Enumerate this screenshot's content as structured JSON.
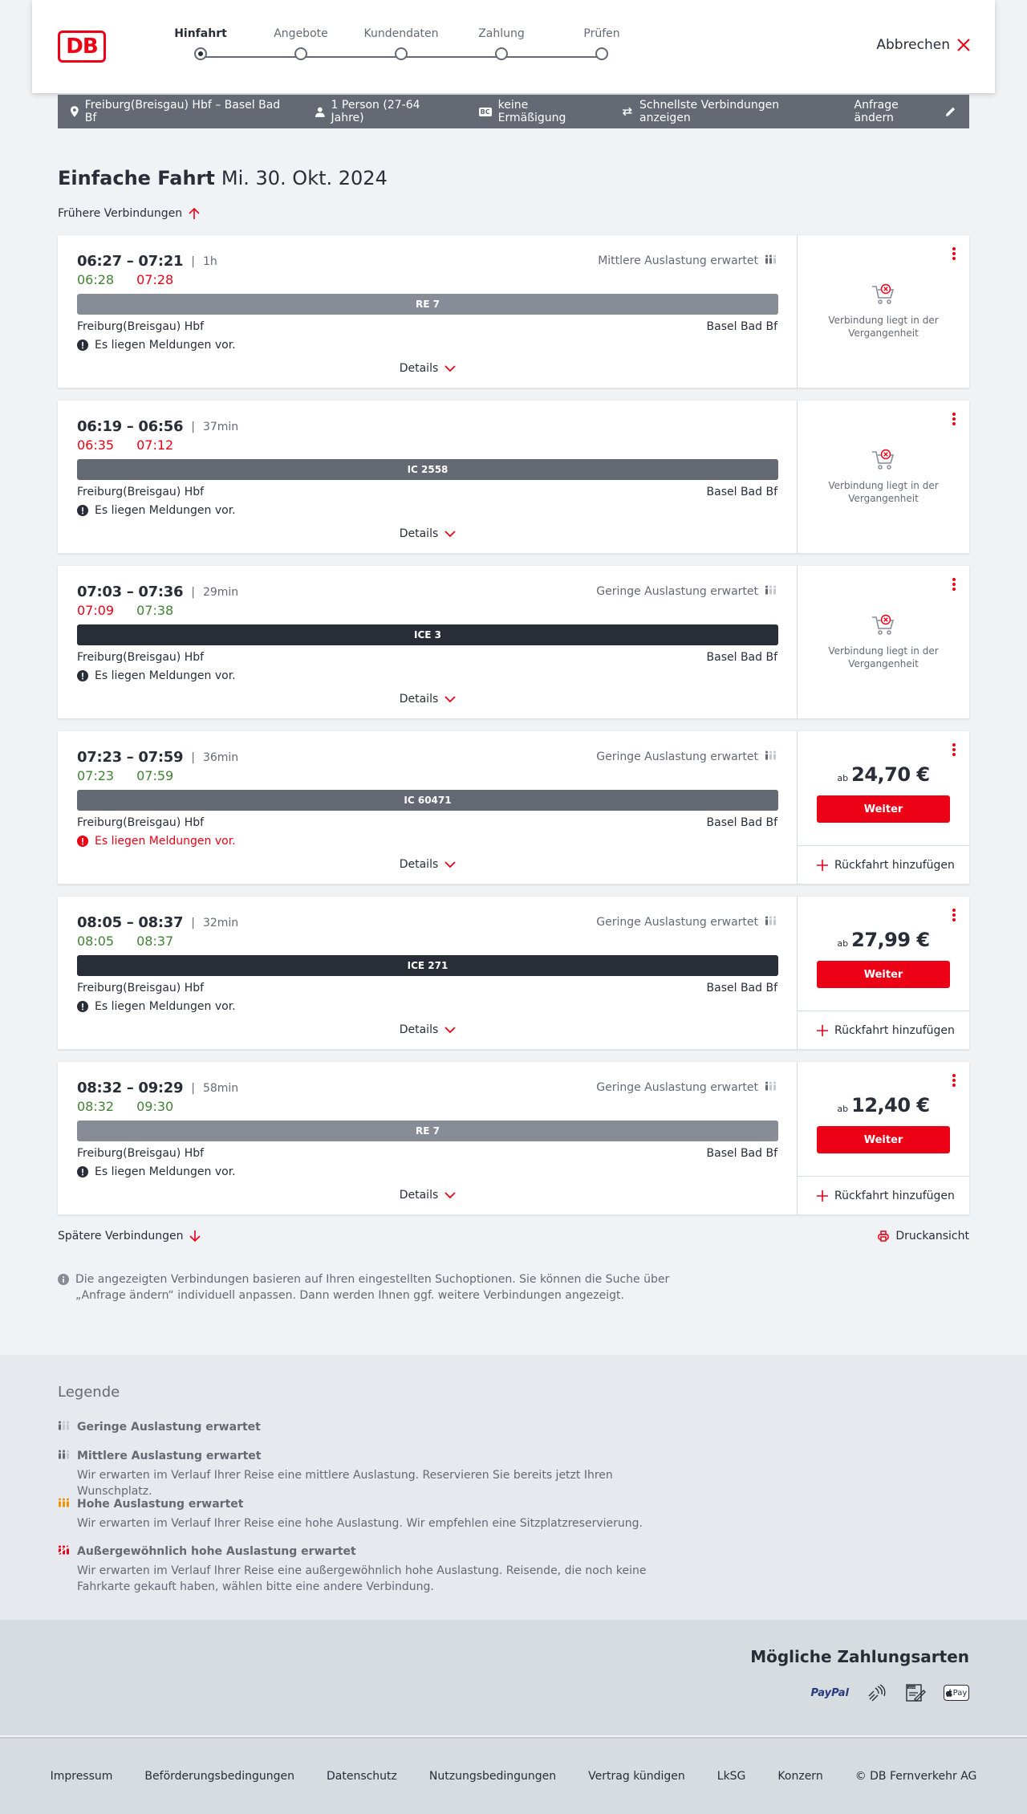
{
  "header": {
    "logo_text": "DB",
    "steps": [
      {
        "label": "Hinfahrt",
        "active": true
      },
      {
        "label": "Angebote",
        "active": false
      },
      {
        "label": "Kundendaten",
        "active": false
      },
      {
        "label": "Zahlung",
        "active": false
      },
      {
        "label": "Prüfen",
        "active": false
      }
    ],
    "cancel_label": "Abbrechen"
  },
  "search": {
    "route": "Freiburg(Breisgau) Hbf – Basel Bad Bf",
    "passengers": "1 Person (27-64 Jahre)",
    "discount_badge": "BC",
    "discount": "keine Ermäßigung",
    "fastest": "Schnellste Verbindungen anzeigen",
    "change": "Anfrage ändern"
  },
  "title": {
    "trip": "Einfache Fahrt",
    "date": "Mi. 30. Okt. 2024"
  },
  "earlier_label": "Frühere Verbindungen",
  "later_label": "Spätere Verbindungen",
  "print_label": "Druckansicht",
  "details_label": "Details",
  "ab_label": "ab",
  "weiter_label": "Weiter",
  "return_label": "Rückfahrt hinzufügen",
  "past_label": "Verbindung liegt in der Vergangenheit",
  "connections": [
    {
      "planned": "06:27 – 07:21",
      "duration": "1h",
      "rt_dep": "06:28",
      "rt_dep_color": "green",
      "rt_arr": "07:28",
      "rt_arr_color": "red",
      "occupancy": "Mittlere Auslastung erwartet",
      "train": "RE 7",
      "train_type": "re",
      "from": "Freiburg(Breisgau) Hbf",
      "to": "Basel Bad Bf",
      "message": "Es liegen Meldungen vor.",
      "message_alert": false,
      "past": true,
      "price": ""
    },
    {
      "planned": "06:19 – 06:56",
      "duration": "37min",
      "rt_dep": "06:35",
      "rt_dep_color": "red",
      "rt_arr": "07:12",
      "rt_arr_color": "red",
      "occupancy": "",
      "train": "IC 2558",
      "train_type": "ic",
      "from": "Freiburg(Breisgau) Hbf",
      "to": "Basel Bad Bf",
      "message": "Es liegen Meldungen vor.",
      "message_alert": false,
      "past": true,
      "price": ""
    },
    {
      "planned": "07:03 – 07:36",
      "duration": "29min",
      "rt_dep": "07:09",
      "rt_dep_color": "red",
      "rt_arr": "07:38",
      "rt_arr_color": "green",
      "occupancy": "Geringe Auslastung erwartet",
      "train": "ICE 3",
      "train_type": "ice",
      "from": "Freiburg(Breisgau) Hbf",
      "to": "Basel Bad Bf",
      "message": "Es liegen Meldungen vor.",
      "message_alert": false,
      "past": true,
      "price": ""
    },
    {
      "planned": "07:23 – 07:59",
      "duration": "36min",
      "rt_dep": "07:23",
      "rt_dep_color": "green",
      "rt_arr": "07:59",
      "rt_arr_color": "green",
      "occupancy": "Geringe Auslastung erwartet",
      "train": "IC 60471",
      "train_type": "ic",
      "from": "Freiburg(Breisgau) Hbf",
      "to": "Basel Bad Bf",
      "message": "Es liegen Meldungen vor.",
      "message_alert": true,
      "past": false,
      "price": "24,70 €"
    },
    {
      "planned": "08:05 – 08:37",
      "duration": "32min",
      "rt_dep": "08:05",
      "rt_dep_color": "green",
      "rt_arr": "08:37",
      "rt_arr_color": "green",
      "occupancy": "Geringe Auslastung erwartet",
      "train": "ICE 271",
      "train_type": "ice",
      "from": "Freiburg(Breisgau) Hbf",
      "to": "Basel Bad Bf",
      "message": "Es liegen Meldungen vor.",
      "message_alert": false,
      "past": false,
      "price": "27,99 €"
    },
    {
      "planned": "08:32 – 09:29",
      "duration": "58min",
      "rt_dep": "08:32",
      "rt_dep_color": "green",
      "rt_arr": "09:30",
      "rt_arr_color": "green",
      "occupancy": "Geringe Auslastung erwartet",
      "train": "RE 7",
      "train_type": "re",
      "from": "Freiburg(Breisgau) Hbf",
      "to": "Basel Bad Bf",
      "message": "Es liegen Meldungen vor.",
      "message_alert": false,
      "past": false,
      "price": "12,40 €"
    }
  ],
  "info_text": "Die angezeigten Verbindungen basieren auf Ihren eingestellten Suchoptionen. Sie können die Suche über „Anfrage ändern“ individuell anpassen. Dann werden Ihnen ggf. weitere Verbindungen angezeigt.",
  "legend": {
    "title": "Legende",
    "items": [
      {
        "title": "Geringe Auslastung erwartet",
        "desc": "",
        "level": 1
      },
      {
        "title": "Mittlere Auslastung erwartet",
        "desc": "Wir erwarten im Verlauf Ihrer Reise eine mittlere Auslastung. Reservieren Sie bereits jetzt Ihren Wunschplatz.",
        "level": 2
      },
      {
        "title": "Hohe Auslastung erwartet",
        "desc": "Wir erwarten im Verlauf Ihrer Reise eine hohe Auslastung. Wir empfehlen eine Sitzplatzreservierung.",
        "level": 3
      },
      {
        "title": "Außergewöhnlich hohe Auslastung erwartet",
        "desc": "Wir erwarten im Verlauf Ihrer Reise eine außergewöhnlich hohe Auslastung. Reisende, die noch keine Fahrkarte gekauft haben, wählen bitte eine andere Verbindung.",
        "level": 4
      }
    ]
  },
  "payment": {
    "title": "Mögliche Zahlungsarten",
    "paypal": "PayPal",
    "sepa": "SEPA",
    "applepay": "Pay"
  },
  "footer": [
    "Impressum",
    "Beförderungsbedingungen",
    "Datenschutz",
    "Nutzungsbedingungen",
    "Vertrag kündigen",
    "LkSG",
    "Konzern",
    "© DB Fernverkehr AG"
  ],
  "colors": {
    "brand_red": "#ec0016",
    "realtime_green": "#408335",
    "bar_dark": "#282d37",
    "bar_mid": "#646973",
    "bar_light": "#878c96",
    "occ_orange": "#f39200"
  }
}
